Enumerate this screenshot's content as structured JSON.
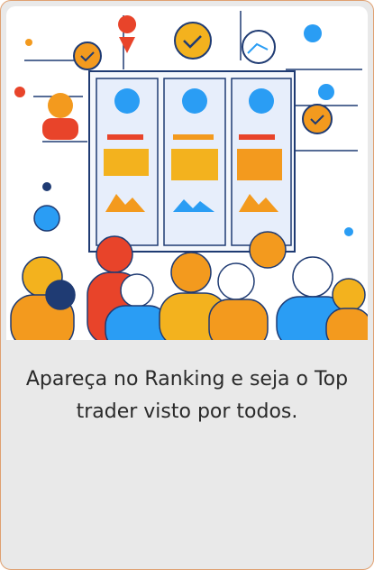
{
  "card": {
    "caption": "Apareça no Ranking e seja o Top trader visto por todos.",
    "illustration": "ranking-people-illustration"
  },
  "colors": {
    "accent_orange": "#f39a1e",
    "accent_blue": "#2a9df4",
    "navy": "#1f3b73",
    "card_bg": "#e9e9e9"
  }
}
